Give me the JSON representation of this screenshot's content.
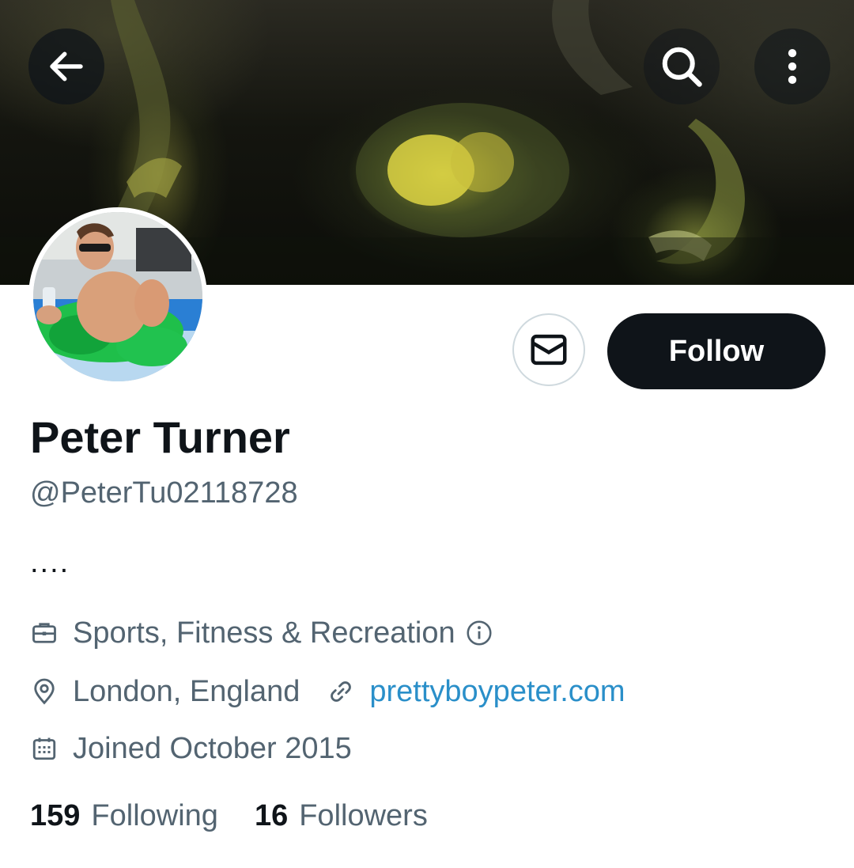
{
  "header": {
    "back_icon": "arrow-left-icon",
    "search_icon": "search-icon",
    "more_icon": "more-vertical-icon"
  },
  "profile": {
    "name": "Peter Turner",
    "handle": "@PeterTu02118728",
    "bio": "....",
    "category": "Sports, Fitness & Recreation",
    "location": "London, England",
    "website": "prettyboypeter.com",
    "joined": "Joined October 2015"
  },
  "actions": {
    "message_icon": "envelope-icon",
    "follow_label": "Follow"
  },
  "stats": {
    "following_count": "159",
    "following_label": "Following",
    "followers_count": "16",
    "followers_label": "Followers"
  },
  "colors": {
    "text_primary": "#0f1419",
    "text_secondary": "#536471",
    "link": "#2a8fc9",
    "follow_bg": "#0f1419"
  }
}
